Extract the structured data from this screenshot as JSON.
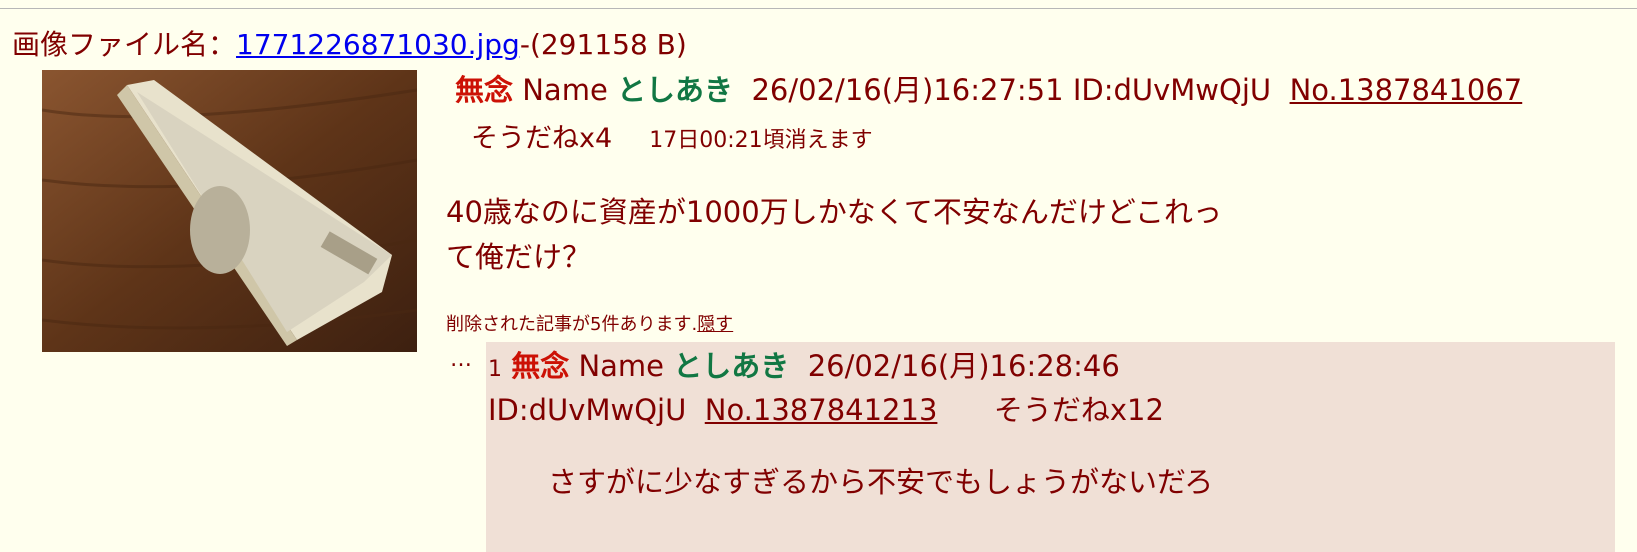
{
  "file": {
    "label": "画像ファイル名：",
    "filename": "1771226871030.jpg",
    "size": "-(291158 B)"
  },
  "post": {
    "subject": "無念",
    "name_label": "Name",
    "name": "としあき",
    "datetime": "26/02/16(月)16:27:51",
    "id": "ID:dUvMwQjU",
    "number": "No.1387841067",
    "sodane": "そうだねx4",
    "expire": "17日00:21頃消えます",
    "body_lines": [
      "40歳なのに資産が1000万しかなくて不安なんだけどこれっ",
      "て俺だけ？"
    ]
  },
  "deleted": {
    "text": "削除された記事が5件あります.",
    "hide_link": "隠す"
  },
  "reply": {
    "dots": "…",
    "index": "1",
    "subject": "無念",
    "name_label": "Name",
    "name": "としあき",
    "datetime": "26/02/16(月)16:28:46",
    "id": "ID:dUvMwQjU",
    "number": "No.1387841213",
    "sodane": "そうだねx12",
    "body": "さすがに少なすぎるから不安でもしょうがないだろ"
  }
}
